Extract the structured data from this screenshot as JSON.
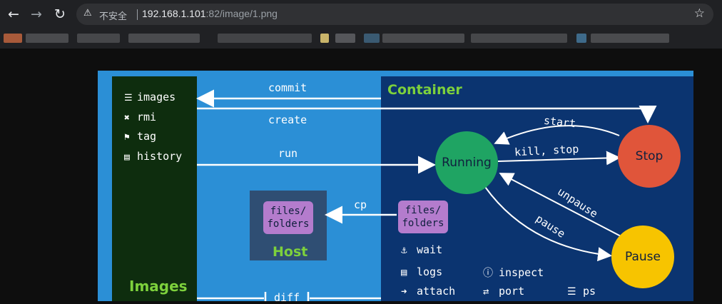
{
  "browser": {
    "url_host": "192.168.1.101",
    "url_rest": ":82/image/1.png",
    "insecure_label": "不安全"
  },
  "diagram": {
    "left_panel": {
      "items": [
        {
          "icon": "list-icon",
          "label": "images"
        },
        {
          "icon": "close-icon",
          "label": "rmi"
        },
        {
          "icon": "tag-icon",
          "label": "tag"
        },
        {
          "icon": "document-icon",
          "label": "history"
        }
      ],
      "title": "Images"
    },
    "container_title": "Container",
    "host_title": "Host",
    "host_box_label": "files/\nfolders",
    "container_box_label": "files/\nfolders",
    "arrows": {
      "commit": "commit",
      "create": "create",
      "run": "run",
      "cp": "cp",
      "diff": "diff",
      "start": "start",
      "kill_stop": "kill, stop",
      "unpause": "unpause",
      "pause": "pause"
    },
    "states": {
      "running": "Running",
      "stop": "Stop",
      "pause": "Pause"
    },
    "commands": [
      {
        "icon": "anchor-icon",
        "label": "wait"
      },
      {
        "icon": "document-icon",
        "label": "logs"
      },
      {
        "icon": "info-icon",
        "label": "inspect"
      },
      {
        "icon": "login-icon",
        "label": "attach"
      },
      {
        "icon": "swap-icon",
        "label": "port"
      },
      {
        "icon": "list-icon",
        "label": "ps"
      }
    ],
    "colors": {
      "background": "#2b8fd6",
      "images_panel": "#0e2d0e",
      "container_panel": "#0b3470",
      "running": "#1fa463",
      "stop": "#e0553a",
      "pause": "#f7c400",
      "box": "#b47ccd",
      "title_green": "#7dd13c"
    }
  }
}
